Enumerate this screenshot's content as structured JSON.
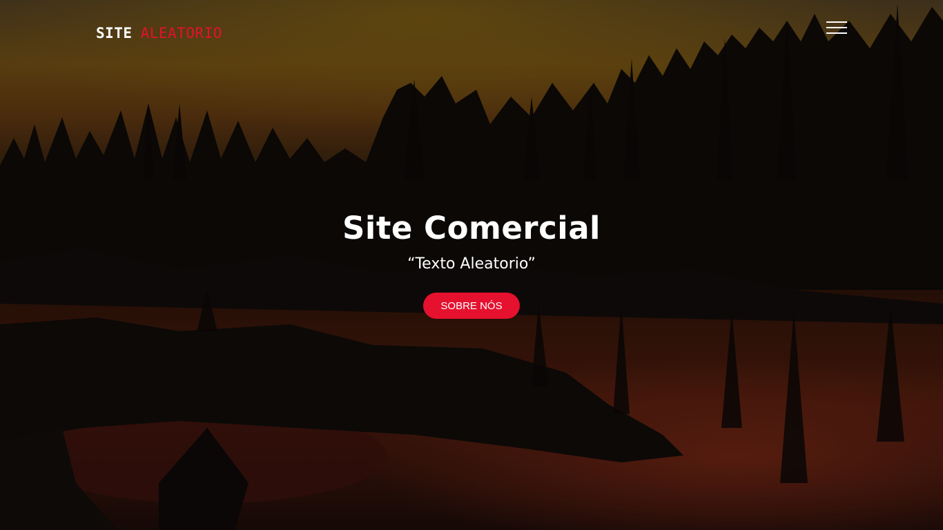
{
  "header": {
    "brand_first": "SITE",
    "brand_second": "ALEATORIO",
    "menu_icon": "hamburger-menu-icon"
  },
  "hero": {
    "title": "Site Comercial",
    "subtitle": "“Texto Aleatorio”",
    "button_label": "SOBRE NÓS"
  },
  "colors": {
    "accent": "#e5112f",
    "text": "#ffffff",
    "background": "#0b0806"
  }
}
